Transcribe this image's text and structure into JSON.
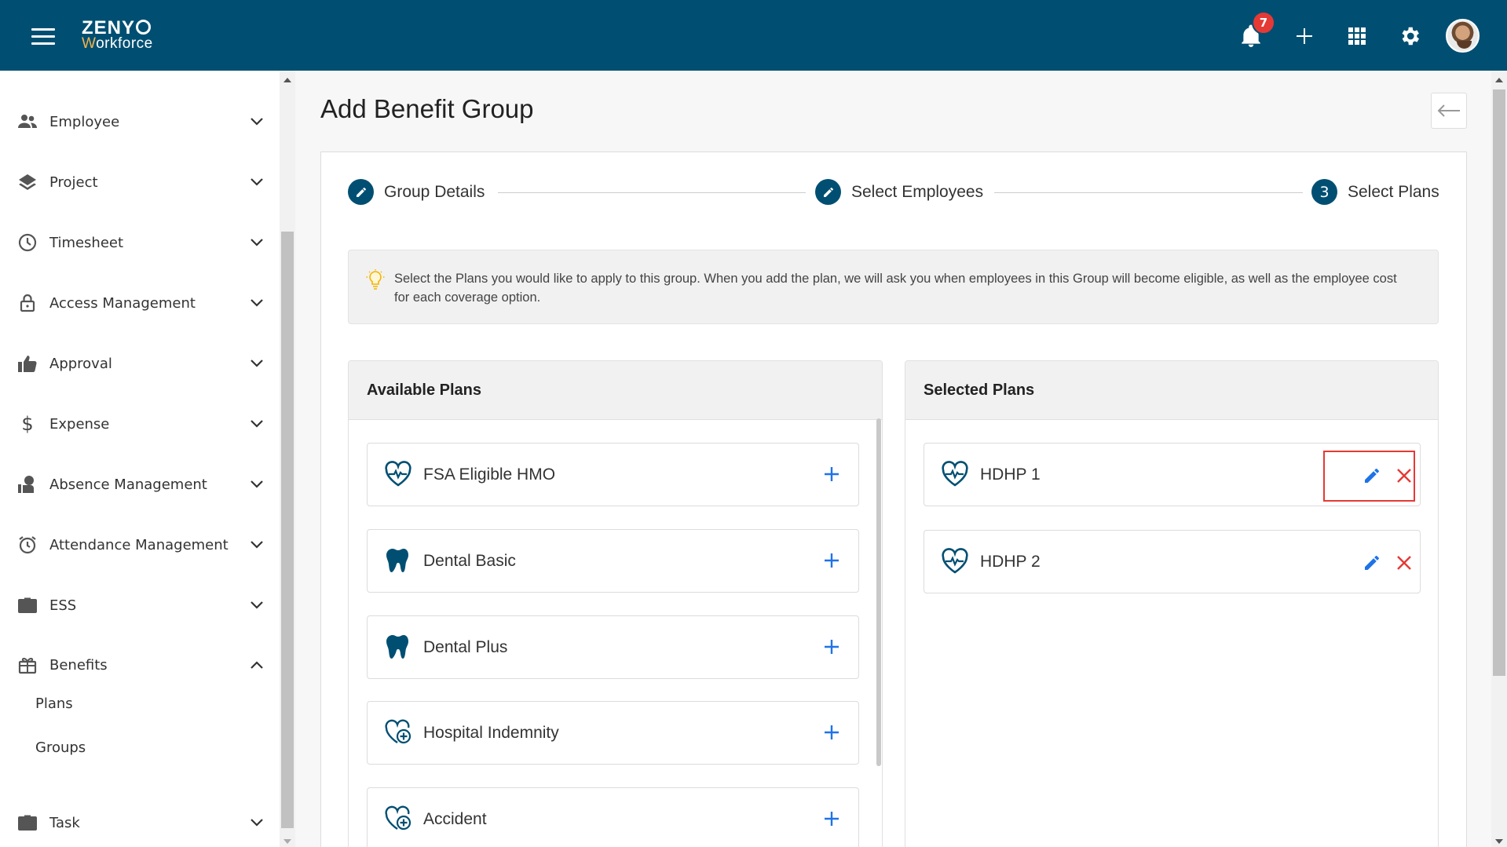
{
  "app": {
    "logo_top": "ZENY",
    "logo_bottom_w": "W",
    "logo_bottom_rest": "orkforce",
    "notification_count": "7"
  },
  "sidebar": {
    "items": [
      {
        "label": "Employee",
        "icon": "people-icon"
      },
      {
        "label": "Project",
        "icon": "layers-icon"
      },
      {
        "label": "Timesheet",
        "icon": "clock-icon"
      },
      {
        "label": "Access Management",
        "icon": "lock-icon"
      },
      {
        "label": "Approval",
        "icon": "thumbs-up-icon"
      },
      {
        "label": "Expense",
        "icon": "dollar-icon"
      },
      {
        "label": "Absence Management",
        "icon": "person-absent-icon"
      },
      {
        "label": "Attendance Management",
        "icon": "alarm-clock-icon"
      },
      {
        "label": "ESS",
        "icon": "briefcase-icon"
      },
      {
        "label": "Benefits",
        "icon": "gift-icon"
      },
      {
        "label": "Task",
        "icon": "briefcase-icon"
      }
    ],
    "benefits_sub": [
      "Plans",
      "Groups"
    ]
  },
  "page": {
    "title": "Add Benefit Group"
  },
  "stepper": {
    "steps": [
      {
        "label": "Group Details",
        "state": "done"
      },
      {
        "label": "Select Employees",
        "state": "done"
      },
      {
        "label": "Select Plans",
        "state": "active",
        "number": "3"
      }
    ]
  },
  "info": {
    "text": "Select the Plans you would like to apply to this group. When you add the plan, we will ask you when employees in this Group will become eligible, as well as the employee cost for each coverage option."
  },
  "available": {
    "title": "Available Plans",
    "plans": [
      {
        "name": "FSA Eligible HMO",
        "icon": "heart-pulse-icon"
      },
      {
        "name": "Dental Basic",
        "icon": "tooth-icon"
      },
      {
        "name": "Dental Plus",
        "icon": "tooth-icon"
      },
      {
        "name": "Hospital Indemnity",
        "icon": "heart-plus-icon"
      },
      {
        "name": "Accident",
        "icon": "heart-plus-icon"
      }
    ]
  },
  "selected": {
    "title": "Selected Plans",
    "plans": [
      {
        "name": "HDHP 1",
        "icon": "heart-pulse-icon"
      },
      {
        "name": "HDHP 2",
        "icon": "heart-pulse-icon"
      }
    ]
  },
  "colors": {
    "brand": "#004f72",
    "accent_blue": "#1e73e8",
    "danger": "#e53935"
  }
}
